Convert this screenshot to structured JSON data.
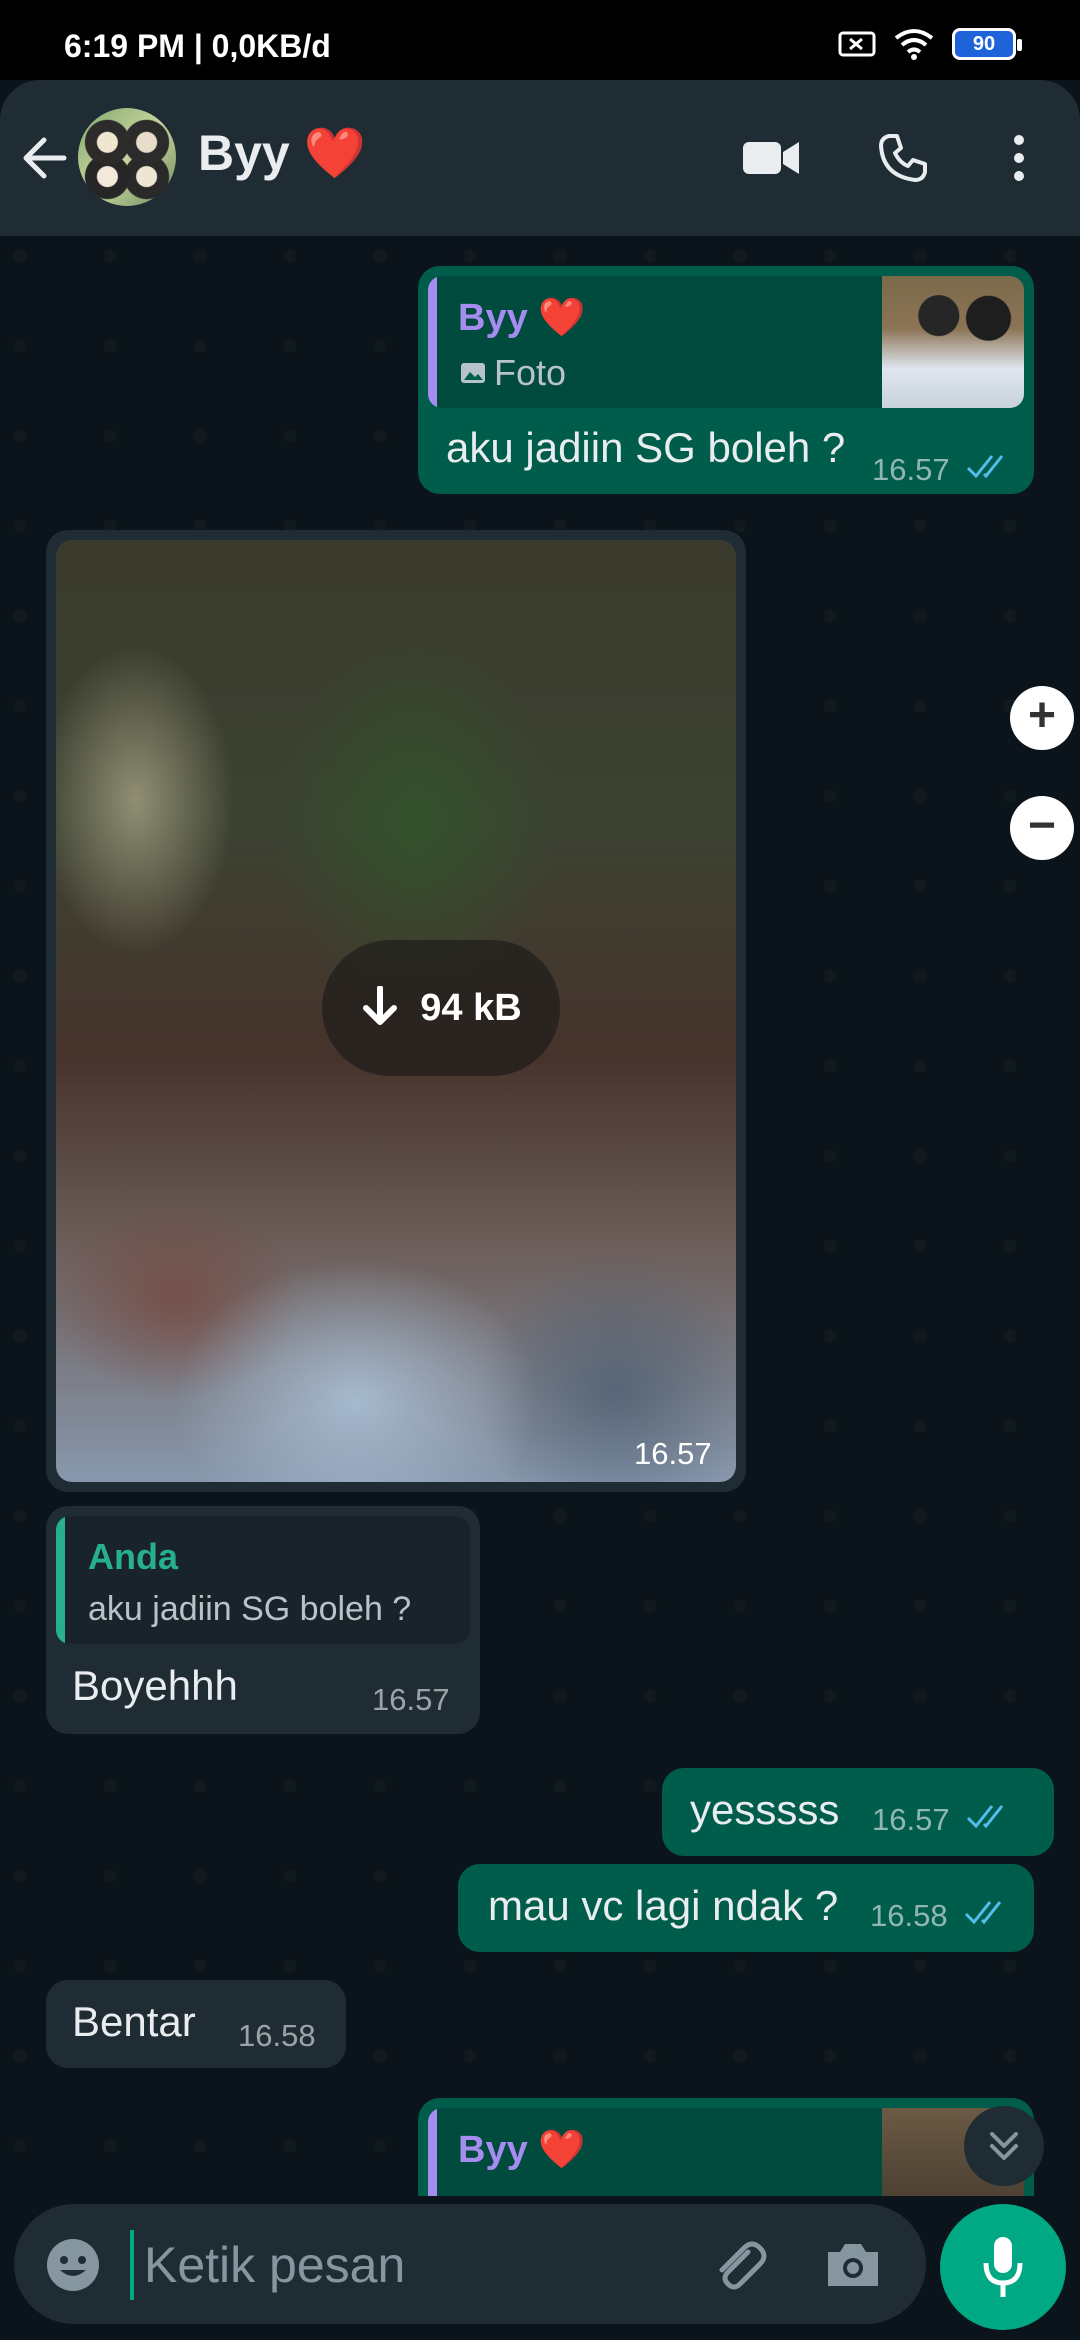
{
  "status_bar": {
    "time": "6:19 PM | 0,0KB/d",
    "battery": "90"
  },
  "header": {
    "contact_name": "Byy ❤️"
  },
  "messages": {
    "m1": {
      "quote_name": "Byy ❤️",
      "quote_label": "Foto",
      "text": "aku jadiin SG boleh ?",
      "time": "16.57"
    },
    "photo": {
      "size": "94 kB",
      "time": "16.57"
    },
    "m2": {
      "quote_name": "Anda",
      "quote_text": "aku jadiin SG boleh ?",
      "text": "Boyehhh",
      "time": "16.57"
    },
    "m3": {
      "text": "yesssss",
      "time": "16.57"
    },
    "m4": {
      "text": "mau vc lagi ndak ?",
      "time": "16.58"
    },
    "m5": {
      "text": "Bentar",
      "time": "16.58"
    },
    "m6": {
      "quote_name": "Byy ❤️"
    }
  },
  "zoom": {
    "plus": "+",
    "minus": "−"
  },
  "composer": {
    "placeholder": "Ketik pesan"
  },
  "colors": {
    "accent": "#00a884",
    "outgoing": "#005c4b",
    "incoming": "#1f2c34",
    "quote_purple": "#a68cf0",
    "quote_green": "#27b08d",
    "tick_blue": "#53bdeb"
  }
}
